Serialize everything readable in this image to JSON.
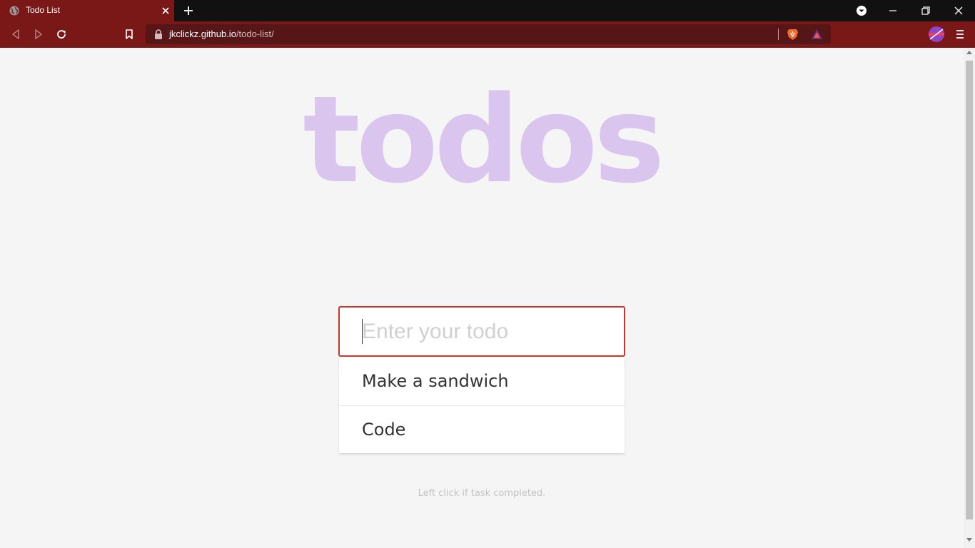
{
  "browser": {
    "tab": {
      "title": "Todo List"
    },
    "url": {
      "domain": "jkclickz.github.io",
      "path": "/todo-list/"
    }
  },
  "page": {
    "title": "todos",
    "input": {
      "placeholder": "Enter your todo",
      "value": ""
    },
    "todos": [
      {
        "text": "Make a sandwich"
      },
      {
        "text": "Code"
      }
    ],
    "hint": "Left click if task completed."
  },
  "colors": {
    "browser_accent": "#7a1717",
    "title": "#d9c5ee",
    "input_border": "#c8382b"
  },
  "icons": [
    "globe-icon",
    "close-icon",
    "plus-icon",
    "dropdown-icon",
    "minimize-icon",
    "restore-icon",
    "back-icon",
    "forward-icon",
    "reload-icon",
    "bookmark-icon",
    "lock-icon",
    "brave-shield-icon",
    "brave-rewards-icon",
    "profile-icon",
    "menu-icon"
  ]
}
